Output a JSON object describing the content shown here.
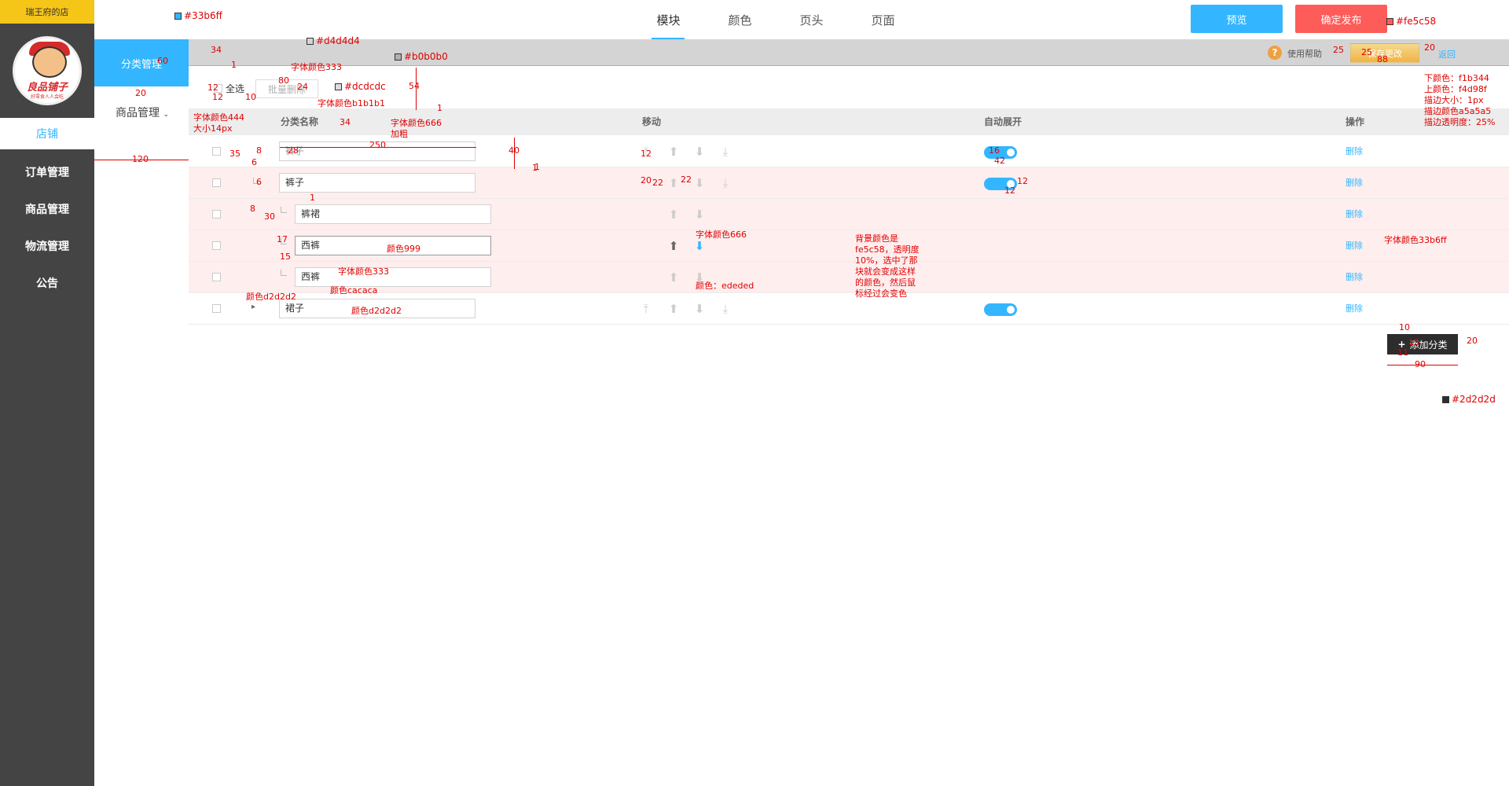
{
  "sidebar": {
    "shop_name": "瑞王府的店",
    "logo_text": "良品铺子",
    "logo_sub": "好零食人人会吃",
    "active": "店铺",
    "items": [
      "订单管理",
      "商品管理",
      "物流管理",
      "公告"
    ]
  },
  "topbar": {
    "tabs": [
      "模块",
      "颜色",
      "页头",
      "页面"
    ],
    "preview": "预览",
    "publish": "确定发布"
  },
  "toolbar": {
    "category_mgmt": "分类管理",
    "help": "使用帮助",
    "save": "保存更改",
    "back": "返回",
    "select_all": "全选",
    "batch_delete": "批量删除",
    "product_mgmt": "商品管理"
  },
  "table": {
    "headers": {
      "name": "分类名称",
      "move": "移动",
      "expand": "自动展开",
      "action": "操作"
    },
    "delete_label": "删除",
    "rows": [
      {
        "name": "裤子",
        "selected": false,
        "level": 1,
        "toggle": true
      },
      {
        "name": "裤子",
        "selected": true,
        "level": 1,
        "toggle": true
      },
      {
        "name": "裤裙",
        "selected": true,
        "level": 2,
        "toggle": false
      },
      {
        "name": "西裤",
        "selected": true,
        "level": 2,
        "toggle": false
      },
      {
        "name": "西裤",
        "selected": true,
        "level": 2,
        "toggle": false
      },
      {
        "name": "裙子",
        "selected": false,
        "level": 1,
        "toggle": true
      }
    ],
    "add_category": "添加分类"
  },
  "colors": {
    "blue": "#33b6ff",
    "red": "#fe5c58",
    "gray_bar": "#d4d4d4",
    "border": "#b0b0b0",
    "btn_border": "#dcdcdc",
    "dark": "#2d2d2d"
  },
  "annotations": {
    "blue_hex": "#33b6ff",
    "gray_hex": "#d4d4d4",
    "border_hex": "#b0b0b0",
    "btn_border_hex": "#dcdcdc",
    "red_hex": "#fe5c58",
    "dark_hex": "#2d2d2d",
    "font333": "字体颜色333",
    "fontb1": "字体颜色b1b1b1",
    "font666": "字体颜色666",
    "bold": "加粗",
    "font444": "字体颜色444",
    "size14": "大小14px",
    "save_btn_desc": [
      "下颜色：f1b344",
      "上颜色：f4d98f",
      "描边大小：1px",
      "描边颜色a5a5a5",
      "描边透明度：25%"
    ],
    "font666b": "字体颜色666",
    "bg_desc": [
      "背景颜色是",
      "fe5c58，透明度",
      "10%，选中了那",
      "块就会变成这样",
      "的颜色，然后鼠",
      "标经过会变色"
    ],
    "font33b": "字体颜色33b6ff",
    "color999": "颜色999",
    "font333b": "字体颜色333",
    "colorcaca": "颜色cacaca",
    "colord2": "颜色d2d2d2",
    "colord2b": "颜色d2d2d2",
    "colored": "颜色：ededed",
    "dims": [
      "34",
      "1",
      "60",
      "20",
      "12",
      "12",
      "10",
      "80",
      "24",
      "54",
      "1",
      "35",
      "8",
      "6",
      "6",
      "8",
      "30",
      "17",
      "15",
      "28",
      "250",
      "34",
      "1",
      "40",
      "1",
      "12",
      "20",
      "22",
      "22",
      "16",
      "42",
      "12",
      "12",
      "25",
      "25",
      "20",
      "88",
      "10",
      "15",
      "20",
      "11",
      "90",
      "120",
      "1"
    ]
  }
}
